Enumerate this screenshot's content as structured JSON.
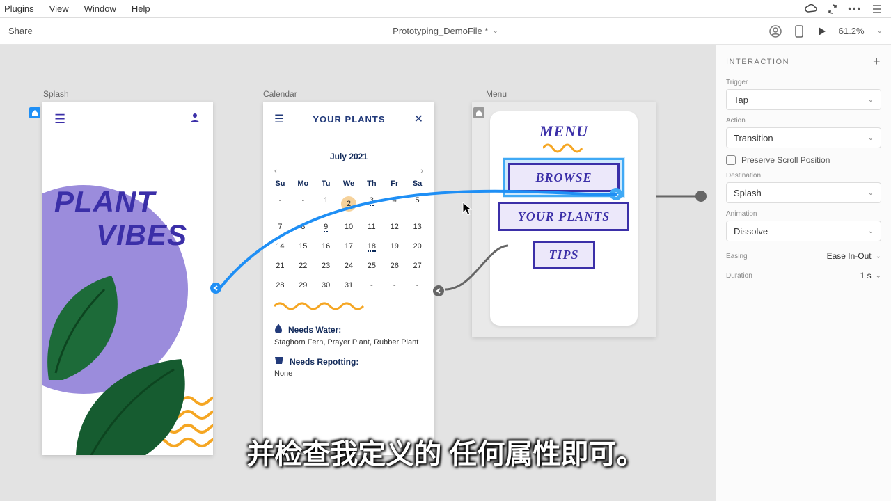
{
  "menubar": {
    "items": [
      "Plugins",
      "View",
      "Window",
      "Help"
    ]
  },
  "topbar": {
    "share": "Share",
    "doc_title": "Prototyping_DemoFile *",
    "zoom": "61.2%"
  },
  "artboards": {
    "splash": {
      "label": "Splash",
      "title_l1": "PLANT",
      "title_l2": "VIBES"
    },
    "calendar": {
      "label": "Calendar",
      "header": "YOUR PLANTS",
      "month": "July 2021",
      "dow": [
        "Su",
        "Mo",
        "Tu",
        "We",
        "Th",
        "Fr",
        "Sa"
      ],
      "weeks": [
        [
          "-",
          "-",
          "1",
          "2",
          "3",
          "4",
          "5"
        ],
        [
          "-",
          "7",
          "8",
          "9",
          "10",
          "11",
          "12",
          "13"
        ],
        [
          "14",
          "15",
          "16",
          "17",
          "18",
          "19",
          "20"
        ],
        [
          "21",
          "22",
          "23",
          "24",
          "25",
          "26",
          "27"
        ],
        [
          "28",
          "29",
          "30",
          "31",
          "-",
          "-",
          "-"
        ]
      ],
      "water_title": "Needs Water:",
      "water_body": "Staghorn Fern, Prayer Plant, Rubber Plant",
      "repot_title": "Needs Repotting:",
      "repot_body": "None"
    },
    "menu": {
      "label": "Menu",
      "title": "MENU",
      "btn_browse": "BROWSE",
      "btn_plants": "YOUR PLANTS",
      "btn_tips": "TIPS"
    }
  },
  "panel": {
    "header": "INTERACTION",
    "trigger_label": "Trigger",
    "trigger_value": "Tap",
    "action_label": "Action",
    "action_value": "Transition",
    "preserve": "Preserve Scroll Position",
    "dest_label": "Destination",
    "dest_value": "Splash",
    "anim_label": "Animation",
    "anim_value": "Dissolve",
    "easing_label": "Easing",
    "easing_value": "Ease In-Out",
    "duration_label": "Duration",
    "duration_value": "1 s"
  },
  "subtitle": "并检查我定义的 任何属性即可。"
}
